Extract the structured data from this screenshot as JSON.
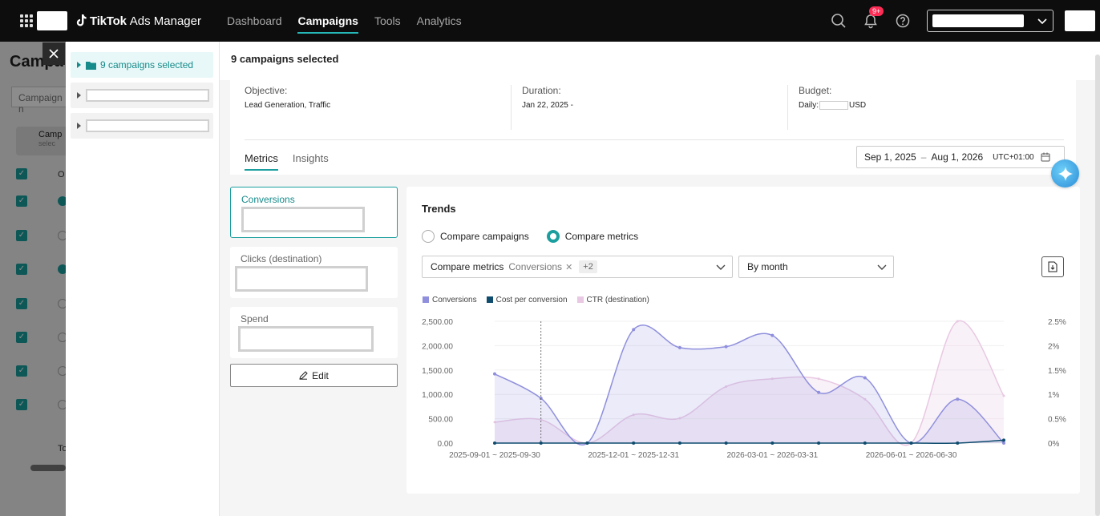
{
  "app": {
    "brand_name": "TikTok",
    "brand_suffix": "Ads Manager",
    "nav": [
      "Dashboard",
      "Campaigns",
      "Tools",
      "Analytics"
    ],
    "notification_badge": "9+"
  },
  "background_page": {
    "title": "Campa",
    "search_placeholder": "Campaign n",
    "card_label": "Camp",
    "card_sub": "selec",
    "table_header": "O",
    "footer_fragment": "To"
  },
  "drawer": {
    "tree_selected": "9 campaigns selected",
    "header_title": "9 campaigns selected",
    "objective_label": "Objective:",
    "objective_value": "Lead Generation, Traffic",
    "duration_label": "Duration:",
    "duration_value": "Jan 22, 2025 -",
    "budget_label": "Budget:",
    "budget_prefix": "Daily:",
    "budget_suffix": "USD",
    "tabs": [
      "Metrics",
      "Insights"
    ],
    "date_start": "Sep 1, 2025",
    "date_sep": "–",
    "date_end": "Aug 1, 2026",
    "timezone": "UTC+01:00"
  },
  "metrics": {
    "cards": [
      "Conversions",
      "Clicks (destination)",
      "Spend"
    ],
    "edit_label": "Edit"
  },
  "trends": {
    "title": "Trends",
    "radio_campaigns": "Compare campaigns",
    "radio_metrics": "Compare metrics",
    "compare_label": "Compare metrics",
    "compare_chip": "Conversions",
    "compare_more": "+2",
    "granularity": "By month"
  },
  "chart_data": {
    "type": "line",
    "legend": [
      "Conversions",
      "Cost per conversion",
      "CTR (destination)"
    ],
    "colors": {
      "conversions": "#8f8fdd",
      "cost": "#0f4c6e",
      "ctr": "#e8c8e2"
    },
    "y_left_ticks": [
      "2,500.00",
      "2,000.00",
      "1,500.00",
      "1,000.00",
      "500.00",
      "0.00"
    ],
    "y_right_ticks": [
      "2.5%",
      "2%",
      "1.5%",
      "1%",
      "0.5%",
      "0%"
    ],
    "x_tick_labels": [
      "2025-09-01 ~ 2025-09-30",
      "2025-12-01 ~ 2025-12-31",
      "2026-03-01 ~ 2026-03-31",
      "2026-06-01 ~ 2026-06-30"
    ],
    "ylim_left": [
      0,
      2500
    ],
    "ylim_right": [
      0,
      2.5
    ],
    "series": [
      {
        "name": "Conversions",
        "axis": "left",
        "values": [
          1420,
          920,
          0,
          2330,
          1960,
          1980,
          2210,
          1040,
          1340,
          0,
          900,
          0
        ]
      },
      {
        "name": "Cost per conversion",
        "axis": "left",
        "values": [
          0,
          0,
          0,
          0,
          0,
          0,
          0,
          0,
          0,
          0,
          0,
          60
        ]
      },
      {
        "name": "CTR (destination)",
        "axis": "right",
        "values": [
          0.43,
          0.48,
          0,
          0.58,
          0.51,
          1.16,
          1.32,
          1.32,
          0.9,
          0,
          2.5,
          0.97
        ]
      }
    ],
    "hover_index": 1
  }
}
